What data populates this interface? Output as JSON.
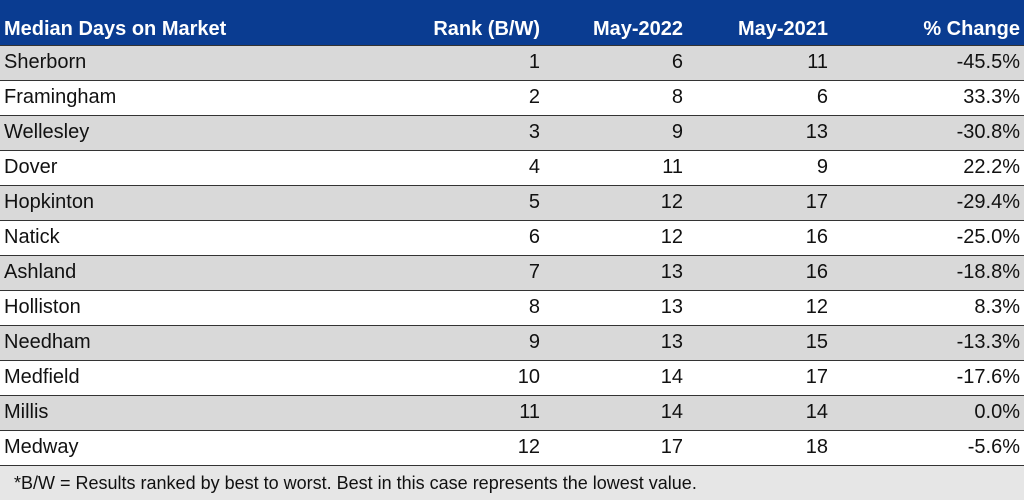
{
  "headers": [
    "Median Days on Market",
    "Rank (B/W)",
    "May-2022",
    "May-2021",
    "% Change"
  ],
  "rows": [
    [
      "Sherborn",
      "1",
      "6",
      "11",
      "-45.5%"
    ],
    [
      "Framingham",
      "2",
      "8",
      "6",
      "33.3%"
    ],
    [
      "Wellesley",
      "3",
      "9",
      "13",
      "-30.8%"
    ],
    [
      "Dover",
      "4",
      "11",
      "9",
      "22.2%"
    ],
    [
      "Hopkinton",
      "5",
      "12",
      "17",
      "-29.4%"
    ],
    [
      "Natick",
      "6",
      "12",
      "16",
      "-25.0%"
    ],
    [
      "Ashland",
      "7",
      "13",
      "16",
      "-18.8%"
    ],
    [
      "Holliston",
      "8",
      "13",
      "12",
      "8.3%"
    ],
    [
      "Needham",
      "9",
      "13",
      "15",
      "-13.3%"
    ],
    [
      "Medfield",
      "10",
      "14",
      "17",
      "-17.6%"
    ],
    [
      "Millis",
      "11",
      "14",
      "14",
      "0.0%"
    ],
    [
      "Medway",
      "12",
      "17",
      "18",
      "-5.6%"
    ]
  ],
  "footnote": "*B/W = Results ranked by best to worst.  Best in this case represents the lowest value.",
  "colors": {
    "header_bg": "#0a3c91",
    "band": "#d9d9d9"
  }
}
